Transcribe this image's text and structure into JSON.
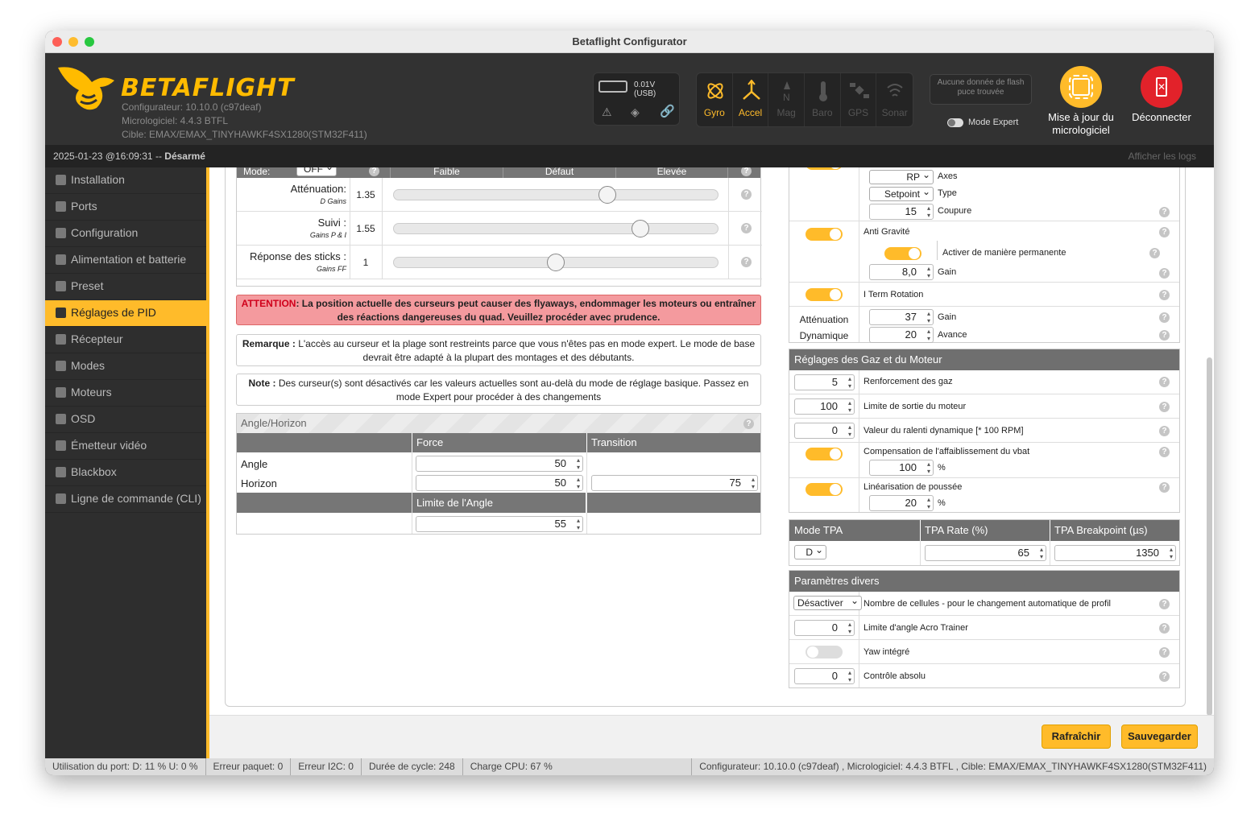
{
  "window": {
    "title": "Betaflight Configurator"
  },
  "header": {
    "brand": "BETAFLIGHT",
    "configurator": "Configurateur: 10.10.0 (c97deaf)",
    "firmware": "Micrologiciel: 4.4.3 BTFL",
    "target": "Cible: EMAX/EMAX_TINYHAWKF4SX1280(STM32F411)",
    "battery": "0.01V (USB)",
    "sensors": [
      "Gyro",
      "Accel",
      "Mag",
      "Baro",
      "GPS",
      "Sonar"
    ],
    "flash": "Aucune donnée de flash puce trouvée",
    "expert_mode": "Mode Expert",
    "update_button": "Mise à jour du micrologiciel",
    "disconnect_button": "Déconnecter"
  },
  "status": {
    "datetime": "2025-01-23 @16:09:31 --",
    "armed": "Désarmé",
    "logs": "Afficher les logs"
  },
  "sidebar": {
    "items": [
      "Installation",
      "Ports",
      "Configuration",
      "Alimentation et batterie",
      "Preset",
      "Réglages de PID",
      "Récepteur",
      "Modes",
      "Moteurs",
      "OSD",
      "Émetteur vidéo",
      "Blackbox",
      "Ligne de commande (CLI)"
    ],
    "active": 5
  },
  "sliders": {
    "header": {
      "mode_label": "Mode:",
      "mode_value": "OFF",
      "low": "Faible",
      "default": "Défaut",
      "high": "Élevée"
    },
    "rows": [
      {
        "label": "Atténuation:",
        "sub": "D Gains",
        "value": "1.35",
        "position": 0.66
      },
      {
        "label": "Suivi :",
        "sub": "Gains P & I",
        "value": "1.55",
        "position": 0.76
      },
      {
        "label": "Réponse des sticks :",
        "sub": "Gains FF",
        "value": "1",
        "position": 0.5
      }
    ]
  },
  "warning": {
    "prefix": "ATTENTION",
    "text": ": La position actuelle des curseurs peut causer des flyaways, endommager les moteurs ou entraîner des réactions dangereuses du quad. Veuillez procéder avec prudence."
  },
  "notes": [
    {
      "bold": "Remarque :",
      "text": " L'accès au curseur et la plage sont restreints parce que vous n'êtes pas en mode expert. Le mode de base devrait être adapté à la plupart des montages et des débutants."
    },
    {
      "bold": "Note :",
      "text": " Des curseur(s) sont désactivés car les valeurs actuelles sont au-delà du mode de réglage basique. Passez en mode Expert pour procéder à des changements"
    }
  ],
  "angle_horizon": {
    "title": "Angle/Horizon",
    "col_force": "Force",
    "col_transition": "Transition",
    "angle_label": "Angle",
    "horizon_label": "Horizon",
    "angle_force": "50",
    "horizon_force": "50",
    "horizon_transition": "75",
    "limit_label": "Limite de l'Angle",
    "limit_value": "55"
  },
  "filters": {
    "axes_value": "RP",
    "axes_label": "Axes",
    "type_value": "Setpoint",
    "type_label": "Type",
    "cutoff_value": "15",
    "cutoff_label": "Coupure",
    "anti_gravity": "Anti Gravité",
    "permanent": "Activer de manière permanente",
    "ag_gain": "8,0",
    "gain_label": "Gain",
    "iterm_rotation": "I Term Rotation",
    "dyn_att": "Atténuation Dynamique",
    "dyn_gain": "37",
    "dyn_gain_label": "Gain",
    "dyn_adv": "20",
    "dyn_adv_label": "Avance"
  },
  "throttle": {
    "title": "Réglages des Gaz et du Moteur",
    "boost_value": "5",
    "boost_label": "Renforcement des gaz",
    "limit_value": "100",
    "limit_label": "Limite de sortie du moteur",
    "idle_value": "0",
    "idle_label": "Valeur du ralenti dynamique [* 100 RPM]",
    "vbat_label": "Compensation de l'affaiblissement du vbat",
    "vbat_value": "100",
    "pct": "%",
    "linear_label": "Linéarisation de poussée",
    "linear_value": "20"
  },
  "tpa": {
    "mode_label": "Mode TPA",
    "rate_label": "TPA Rate (%)",
    "breakpoint_label": "TPA Breakpoint (µs)",
    "mode_value": "D",
    "rate_value": "65",
    "breakpoint_value": "1350"
  },
  "misc": {
    "title": "Paramètres divers",
    "cells_value": "Désactiver",
    "cells_label": "Nombre de cellules - pour le changement automatique de profil",
    "acro_value": "0",
    "acro_label": "Limite d'angle Acro Trainer",
    "yaw_label": "Yaw intégré",
    "abs_value": "0",
    "abs_label": "Contrôle absolu"
  },
  "buttons": {
    "refresh": "Rafraîchir",
    "save": "Sauvegarder"
  },
  "footer": {
    "port": "Utilisation du port: D: 11 % U: 0 %",
    "packet": "Erreur paquet: 0",
    "i2c": "Erreur I2C: 0",
    "cycle": "Durée de cycle: 248",
    "cpu": "Charge CPU: 67 %",
    "info": "Configurateur: 10.10.0 (c97deaf) , Micrologiciel: 4.4.3 BTFL , Cible: EMAX/EMAX_TINYHAWKF4SX1280(STM32F411)"
  },
  "colors": {
    "accent": "#ffbb2a",
    "warning": "#f49a9e",
    "disconnect": "#e2222a"
  }
}
